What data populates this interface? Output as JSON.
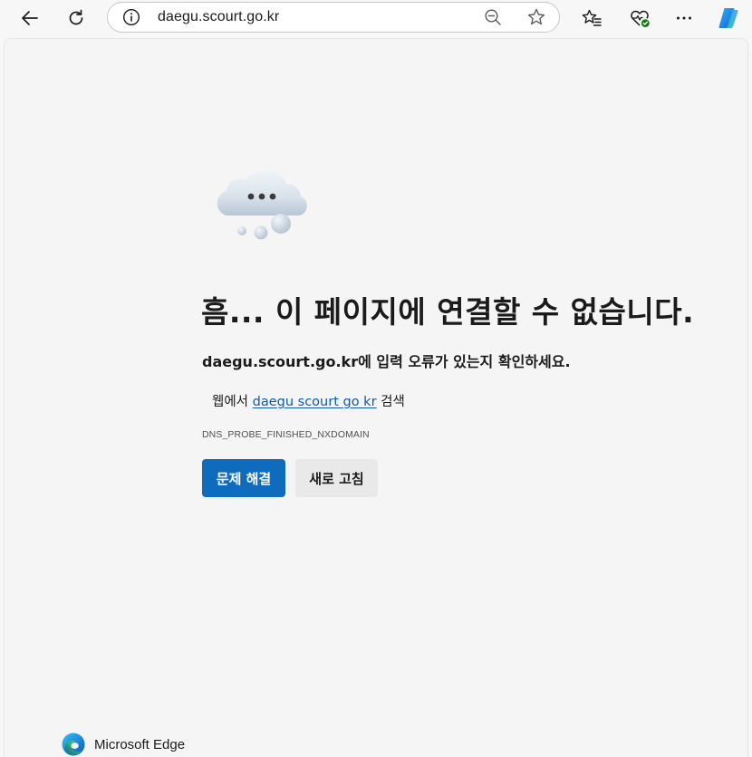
{
  "browser": {
    "address_bar": {
      "url": "daegu.scourt.go.kr"
    },
    "icons": {
      "back": "back-arrow-icon",
      "refresh": "refresh-icon",
      "site_info": "info-icon",
      "zoom": "zoom-out-icon",
      "favorite": "star-icon",
      "favorites_bar": "favorites-icon",
      "browser_essentials": "heart-pulse-icon",
      "more": "more-dots-icon",
      "copilot": "copilot-icon"
    }
  },
  "error_page": {
    "illustration": "cloud-icon",
    "headline": "흠... 이 페이지에 연결할 수 없습니다.",
    "subtext": "daegu.scourt.go.kr에 입력 오류가 있는지 확인하세요.",
    "search_prefix": "웹에서",
    "search_link": "daegu scourt go kr",
    "search_suffix": "검색",
    "error_code": "DNS_PROBE_FINISHED_NXDOMAIN",
    "primary_button": "문제 해결",
    "secondary_button": "새로 고침"
  },
  "footer": {
    "brand_name": "Microsoft Edge"
  },
  "colors": {
    "primary_button": "#0f6cbd",
    "link": "#0b5cad",
    "background": "#f5f5f5"
  }
}
